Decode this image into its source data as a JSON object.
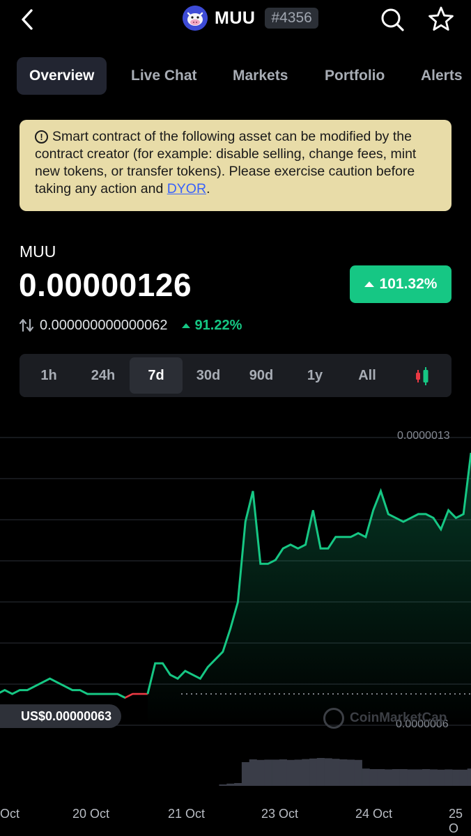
{
  "header": {
    "coin_name": "MUU",
    "rank": "#4356",
    "icons": [
      "back-arrow-icon",
      "coin-logo-icon",
      "search-icon",
      "star-icon"
    ]
  },
  "tabs": [
    {
      "label": "Overview",
      "active": true
    },
    {
      "label": "Live Chat"
    },
    {
      "label": "Markets"
    },
    {
      "label": "Portfolio"
    },
    {
      "label": "Alerts"
    }
  ],
  "warning": {
    "text": "Smart contract of the following asset can be modified by the contract creator (for example: disable selling, change fees, mint new tokens, or transfer tokens). Please exercise caution before taking any action and ",
    "link": "DYOR",
    "end": ".",
    "bg_color": "#e8dca8",
    "link_color": "#3861fb"
  },
  "price_block": {
    "symbol": "MUU",
    "price": "0.00000126",
    "change_pct": "101.32%",
    "secondary_price": "0.000000000000062",
    "secondary_change": "91.22%",
    "up_color": "#16c784",
    "down_color": "#ea3943"
  },
  "range_buttons": [
    {
      "label": "1h"
    },
    {
      "label": "24h"
    },
    {
      "label": "7d",
      "active": true
    },
    {
      "label": "30d"
    },
    {
      "label": "90d"
    },
    {
      "label": "1y"
    },
    {
      "label": "All"
    }
  ],
  "chart": {
    "y_top_label": "0.0000013",
    "y_bottom_label": "0.0000006",
    "reference_price_label": "US$0.00000063",
    "watermark": "CoinMarketCap",
    "date_labels": [
      "Oct",
      "20 Oct",
      "21 Oct",
      "23 Oct",
      "24 Oct",
      "25 O"
    ]
  },
  "chart_data": {
    "type": "line",
    "title": "",
    "xlabel": "",
    "ylabel": "",
    "reference_value": 6.3e-07,
    "y_ticks_shown": [
      1.3e-06,
      6e-07
    ],
    "x_tick_labels": [
      "Oct",
      "20 Oct",
      "21 Oct",
      "23 Oct",
      "24 Oct",
      "25 O"
    ],
    "series": [
      {
        "values": [
          6.3e-07,
          6.4e-07,
          6.3e-07,
          6.4e-07,
          6.4e-07,
          6.5e-07,
          6.6e-07,
          6.7e-07,
          6.6e-07,
          6.5e-07,
          6.4e-07,
          6.4e-07,
          6.3e-07,
          6.3e-07,
          6.3e-07,
          6.3e-07,
          6.3e-07,
          6.2e-07,
          6.3e-07,
          6.3e-07,
          6.3e-07,
          7.1e-07,
          7.1e-07,
          6.8e-07,
          6.7e-07,
          6.9e-07,
          6.8e-07,
          6.7e-07,
          7e-07,
          7.2e-07,
          7.4e-07,
          8e-07,
          8.7e-07,
          1.08e-06,
          1.16e-06,
          9.7e-07,
          9.7e-07,
          9.8e-07,
          1.01e-06,
          1.02e-06,
          1.01e-06,
          1.02e-06,
          1.11e-06,
          1.01e-06,
          1.01e-06,
          1.04e-06,
          1.04e-06,
          1.04e-06,
          1.05e-06,
          1.04e-06,
          1.11e-06,
          1.16e-06,
          1.1e-06,
          1.09e-06,
          1.08e-06,
          1.09e-06,
          1.1e-06,
          1.1e-06,
          1.09e-06,
          1.06e-06,
          1.11e-06,
          1.09e-06,
          1.1e-06,
          1.26e-06
        ]
      }
    ],
    "volume": [
      0,
      0,
      0,
      0,
      0,
      0,
      0,
      0,
      0,
      0,
      0,
      0,
      0,
      0,
      0,
      0,
      0,
      0,
      0,
      0,
      0,
      0,
      0,
      0,
      0,
      0,
      0,
      0,
      0,
      0,
      0.05,
      0.08,
      0.1,
      0.85,
      0.95,
      0.93,
      0.94,
      0.94,
      0.95,
      0.93,
      0.94,
      0.96,
      0.98,
      1.0,
      0.99,
      0.97,
      0.95,
      0.94,
      0.93,
      0.62,
      0.6,
      0.6,
      0.59,
      0.6,
      0.6,
      0.59,
      0.59,
      0.6,
      0.59,
      0.58,
      0.59,
      0.58,
      0.58,
      0.62
    ],
    "ylim": [
      5.5e-07,
      1.3e-06
    ]
  }
}
